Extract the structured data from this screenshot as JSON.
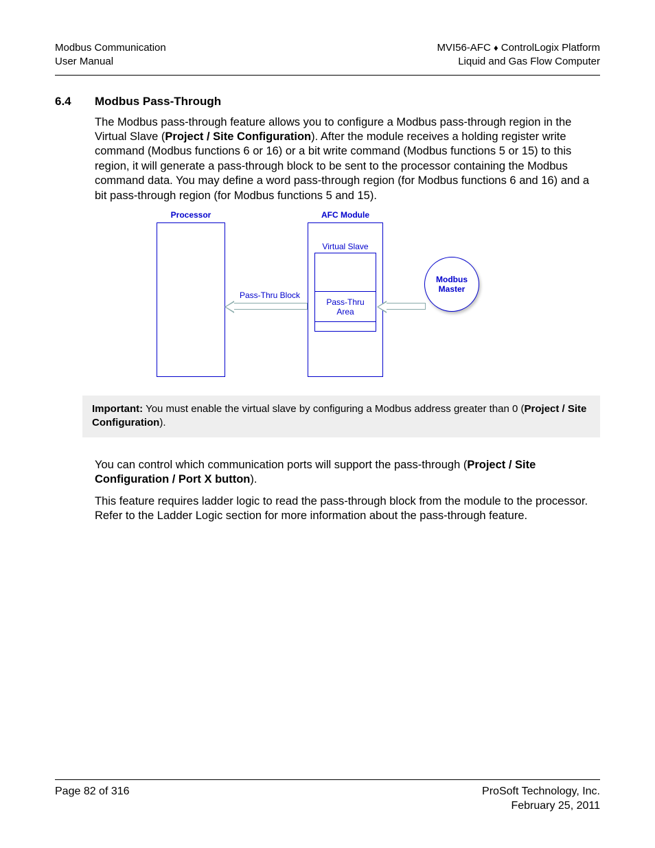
{
  "header": {
    "left1": "Modbus Communication",
    "left2": "User Manual",
    "right1_a": "MVI56-AFC ",
    "right1_b": " ControlLogix Platform",
    "right2": "Liquid and Gas Flow Computer"
  },
  "section": {
    "number": "6.4",
    "title": "Modbus Pass-Through"
  },
  "para1": {
    "t1": "The Modbus pass-through feature allows you to configure a Modbus pass-through region in the Virtual Slave (",
    "b1": "Project / Site Configuration",
    "t2": "). After the module receives a holding register write command (Modbus functions 6 or 16) or a bit write command (Modbus functions 5 or 15) to this region, it will generate a pass-through block to be sent to the processor containing the Modbus command data. You may define a word pass-through region (for Modbus functions 6 and 16) and a bit pass-through region (for Modbus functions 5 and 15)."
  },
  "diagram": {
    "processor": "Processor",
    "afc_module": "AFC Module",
    "virtual_slave": "Virtual Slave",
    "pass_thru_block": "Pass-Thru Block",
    "pass_thru_area": "Pass-Thru\nArea",
    "modbus_master": "Modbus\nMaster"
  },
  "important": {
    "label": "Important:",
    "t1": " You must enable the virtual slave by configuring a Modbus address greater than 0 (",
    "b1": "Project / Site Configuration",
    "t2": ")."
  },
  "para2": {
    "t1": "You can control which communication ports will support the pass-through (",
    "b1": "Project / Site Configuration / Port X button",
    "t2": ")."
  },
  "para3": "This feature requires ladder logic to read the pass-through block from the module to the processor. Refer to the Ladder Logic section for more information about the pass-through feature.",
  "footer": {
    "left": "Page 82 of 316",
    "right1": "ProSoft Technology, Inc.",
    "right2": "February 25, 2011"
  }
}
